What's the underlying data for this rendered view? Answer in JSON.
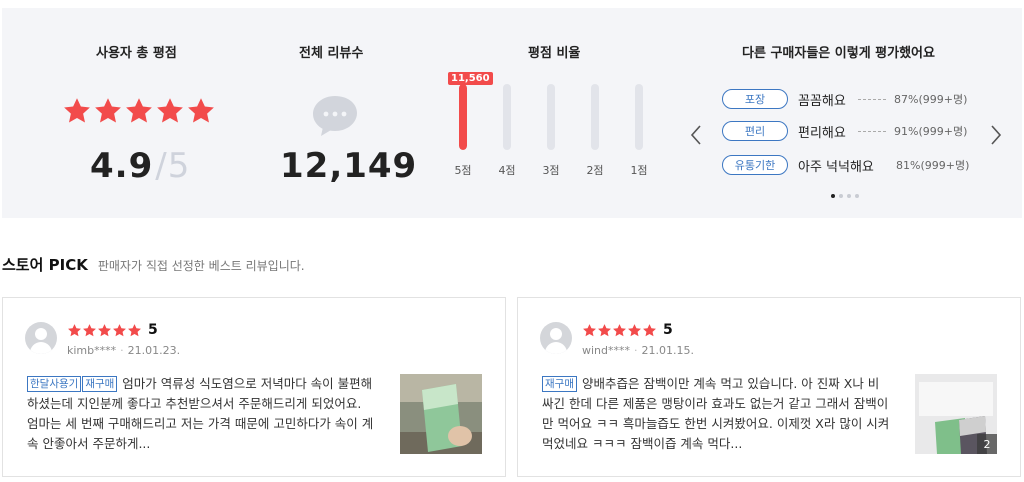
{
  "summary": {
    "avg_rating_title": "사용자 총 평점",
    "avg_rating": "4.9",
    "avg_rating_slash": "/",
    "avg_rating_max": "5",
    "star_fill": 1.0,
    "review_count_title": "전체 리뷰수",
    "review_count": "12,149",
    "distribution_title": "평점 비율",
    "distribution": [
      {
        "label": "5점",
        "fraction": 1.0,
        "count_label": "11,560"
      },
      {
        "label": "4점",
        "fraction": 0.0
      },
      {
        "label": "3점",
        "fraction": 0.0
      },
      {
        "label": "2점",
        "fraction": 0.0
      },
      {
        "label": "1점",
        "fraction": 0.0
      }
    ],
    "evaluation_title": "다른 구매자들은 이렇게 평가했어요",
    "evaluations": [
      {
        "tag": "포장",
        "text": "꼼꼼해요",
        "pct": "87%(999+명)"
      },
      {
        "tag": "편리",
        "text": "편리해요",
        "pct": "91%(999+명)"
      },
      {
        "tag": "유통기한",
        "text": "아주 넉넉해요",
        "pct": "81%(999+명)"
      }
    ],
    "carousel_page": 1,
    "carousel_pages": 4,
    "prev_icon": "chevron-left-icon",
    "next_icon": "chevron-right-icon"
  },
  "store_pick": {
    "title": "스토어 PICK",
    "subtitle": "판매자가 직접 선정한 베스트 리뷰입니다."
  },
  "reviews": [
    {
      "score": "5",
      "user": "kimb****",
      "date": "21.01.23.",
      "tags": [
        "한달사용기",
        "재구매"
      ],
      "text": "엄마가 역류성 식도염으로 저녁마다 속이 불편해 하셨는데 지인분께 좋다고 추천받으셔서 주문해드리게 되었어요. 엄마는 세 번째 구매해드리고 저는 가격 때문에 고민하다가 속이 계속 안좋아서 주문하게...",
      "photo_count": ""
    },
    {
      "score": "5",
      "user": "wind****",
      "date": "21.01.15.",
      "tags": [
        "재구매"
      ],
      "text": "양배추즙은 잠백이만 계속 먹고 있습니다. 아 진짜 X나 비싸긴 한데 다른 제품은 맹탕이라 효과도 없는거 같고 그래서 잠백이만 먹어요 ㅋㅋ 흑마늘즙도 한번 시켜봤어요. 이제껏 X라 많이 시켜먹었네요 ㅋㅋㅋ 잠백이즙 계속 먹다...",
      "photo_count": "2"
    }
  ],
  "colors": {
    "accent_red": "#f24b4b",
    "tag_blue": "#3c77c2",
    "panel_bg": "#f4f5f8"
  }
}
